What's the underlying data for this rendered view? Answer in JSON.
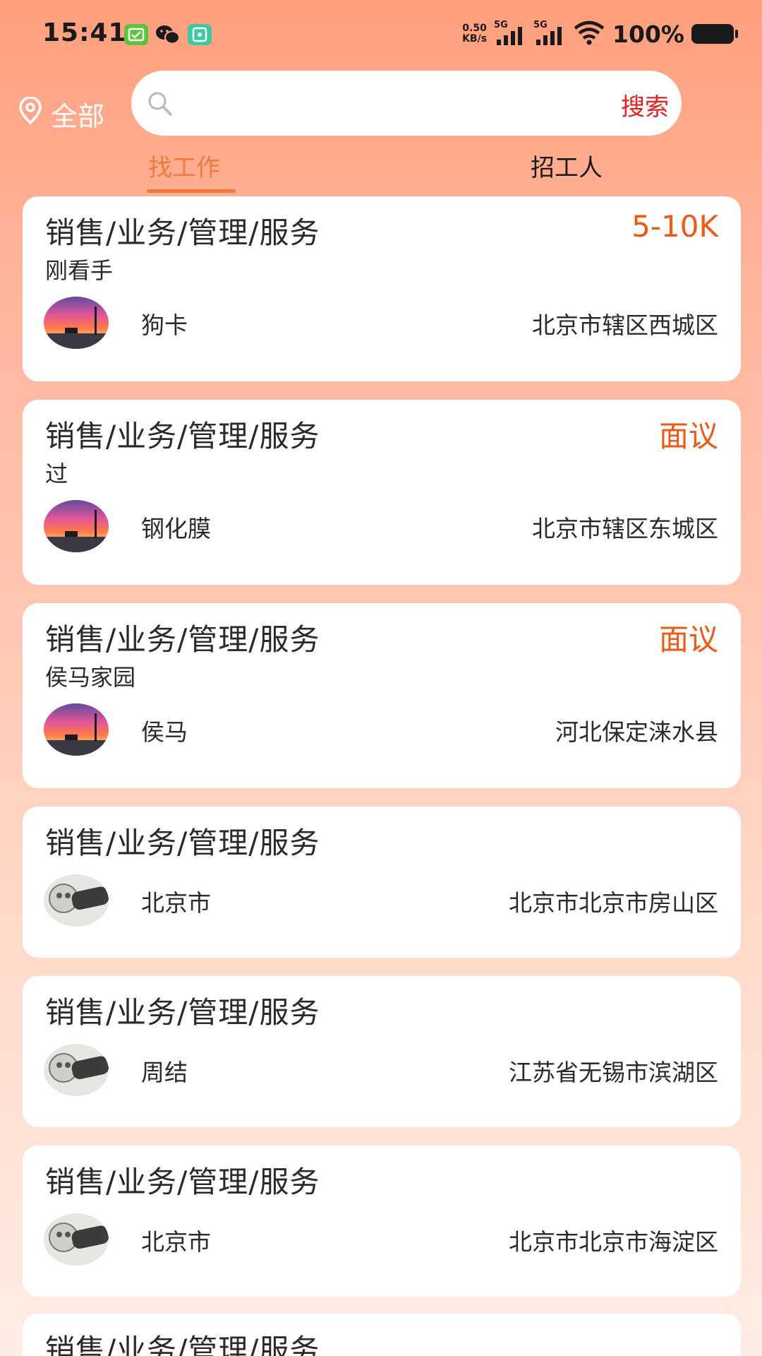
{
  "status_bar": {
    "time": "15:41",
    "net_speed_value": "0.50",
    "net_speed_unit": "KB/s",
    "signal1": "5G",
    "signal2": "5G",
    "battery": "100%"
  },
  "header": {
    "location_label": "全部",
    "search": {
      "placeholder": "",
      "value": "",
      "button_label": "搜索"
    }
  },
  "tabs": [
    {
      "label": "找工作",
      "active": true
    },
    {
      "label": "招工人",
      "active": false
    }
  ],
  "jobs": [
    {
      "title": "销售/业务/管理/服务",
      "salary": "5-10K",
      "subtitle": "刚看手",
      "name": "狗卡",
      "address": "北京市辖区西城区",
      "avatar": "sunset-photo"
    },
    {
      "title": "销售/业务/管理/服务",
      "salary": "面议",
      "subtitle": "过",
      "name": "钢化膜",
      "address": "北京市辖区东城区",
      "avatar": "sunset-photo"
    },
    {
      "title": "销售/业务/管理/服务",
      "salary": "面议",
      "subtitle": "侯马家园",
      "name": "侯马",
      "address": "河北保定涞水县",
      "avatar": "sunset-photo"
    },
    {
      "title": "销售/业务/管理/服务",
      "salary": "",
      "subtitle": "",
      "name": "北京市",
      "address": "北京市北京市房山区",
      "avatar": "sketch-photo"
    },
    {
      "title": "销售/业务/管理/服务",
      "salary": "",
      "subtitle": "",
      "name": "周结",
      "address": "江苏省无锡市滨湖区",
      "avatar": "sketch-photo"
    },
    {
      "title": "销售/业务/管理/服务",
      "salary": "",
      "subtitle": "",
      "name": "北京市",
      "address": "北京市北京市海淀区",
      "avatar": "sketch-photo"
    },
    {
      "title": "销售/业务/管理/服务",
      "salary": "",
      "subtitle": "",
      "name": "",
      "address": "",
      "avatar": ""
    }
  ],
  "colors": {
    "accent": "#f07a3c",
    "salary": "#ec5a14",
    "search_button": "#e8201c"
  }
}
